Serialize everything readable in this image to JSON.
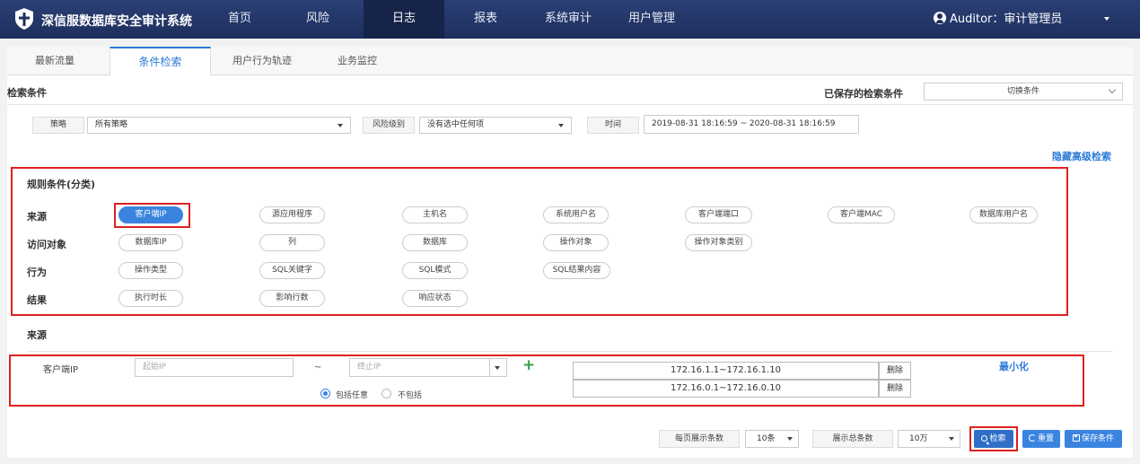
{
  "app": {
    "brand": "深信服数据库安全审计系统"
  },
  "nav": {
    "items": [
      {
        "label": "首页"
      },
      {
        "label": "风险"
      },
      {
        "label": "日志"
      },
      {
        "label": "报表"
      },
      {
        "label": "系统审计"
      },
      {
        "label": "用户管理"
      }
    ],
    "active": "日志",
    "user_label": "Auditor：审计管理员"
  },
  "tabs": [
    {
      "label": "最新流量"
    },
    {
      "label": "条件检索"
    },
    {
      "label": "用户行为轨迹"
    },
    {
      "label": "业务监控"
    }
  ],
  "search": {
    "title": "检索条件",
    "saved_label": "已保存的检索条件",
    "saved_select": "切换条件",
    "policy_label": "策略",
    "policy_value": "所有策略",
    "risk_label": "风险级别",
    "risk_value": "没有选中任何项",
    "time_label": "时间",
    "time_value": "2019-08-31 18:16:59 ~ 2020-08-31 18:16:59",
    "hide_advanced": "隐藏高级检索"
  },
  "rules": {
    "title": "规则条件(分类)",
    "rows": [
      {
        "label": "来源",
        "pills": [
          "客户端IP",
          "源应用程序",
          "主机名",
          "系统用户名",
          "客户端端口",
          "客户端MAC",
          "数据库用户名"
        ]
      },
      {
        "label": "访问对象",
        "pills": [
          "数据库IP",
          "列",
          "数据库",
          "操作对象",
          "操作对象类别"
        ]
      },
      {
        "label": "行为",
        "pills": [
          "操作类型",
          "SQL关键字",
          "SQL模式",
          "SQL结果内容"
        ]
      },
      {
        "label": "结果",
        "pills": [
          "执行时长",
          "影响行数",
          "响应状态"
        ]
      }
    ],
    "selected": "客户端IP"
  },
  "source": {
    "title": "来源",
    "field_label": "客户端IP",
    "start_placeholder": "起始IP",
    "tilde": "~",
    "end_placeholder": "终止IP",
    "include_any": "包括任意",
    "exclude": "不包括",
    "minimize": "最小化",
    "ranges": [
      {
        "range": "172.16.1.1~172.16.1.10",
        "delete": "删除"
      },
      {
        "range": "172.16.0.1~172.16.0.10",
        "delete": "删除"
      }
    ]
  },
  "footer": {
    "per_page_label": "每页展示条数",
    "per_page_value": "10条",
    "total_label": "展示总条数",
    "total_value": "10万",
    "search_button": "检索",
    "reset_button": "重置",
    "save_button": "保存条件"
  }
}
